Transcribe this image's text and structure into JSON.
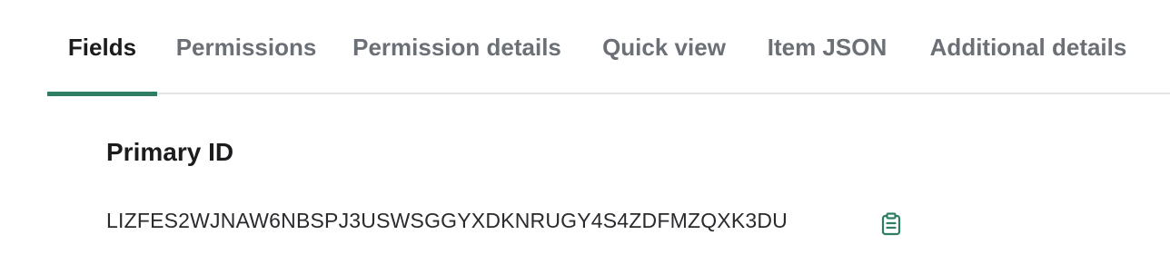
{
  "tabs": [
    {
      "label": "Fields",
      "active": true
    },
    {
      "label": "Permissions",
      "active": false
    },
    {
      "label": "Permission details",
      "active": false
    },
    {
      "label": "Quick view",
      "active": false
    },
    {
      "label": "Item JSON",
      "active": false
    },
    {
      "label": "Additional details",
      "active": false
    }
  ],
  "section": {
    "title": "Primary ID",
    "value": "LIZFES2WJNAW6NBSPJ3USWSGGYXDKNRUGY4S4ZDFMZQXK3DU",
    "copy_icon": "clipboard-icon"
  },
  "colors": {
    "accent": "#2f7d63",
    "tab_inactive": "#6b6f76",
    "tab_active": "#1c1c1e",
    "divider": "#e4e4e7"
  }
}
